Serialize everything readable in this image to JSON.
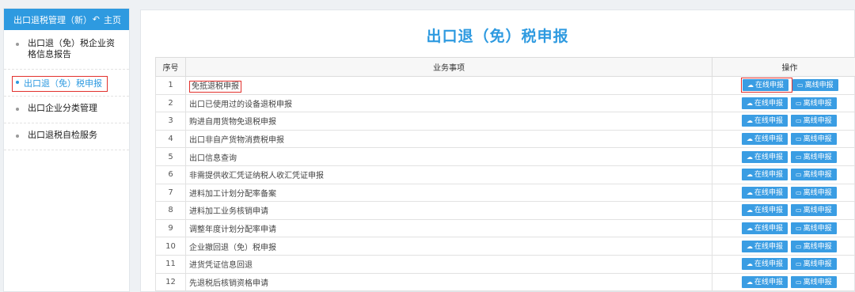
{
  "sidebar": {
    "title": "出口退税管理（新）",
    "home_label": "主页",
    "items": [
      {
        "label": "出口退（免）税企业资格信息报告"
      },
      {
        "label": "出口退（免）税申报"
      },
      {
        "label": "出口企业分类管理"
      },
      {
        "label": "出口退税自检服务"
      }
    ]
  },
  "main": {
    "title": "出口退（免）税申报",
    "columns": {
      "no": "序号",
      "item": "业务事项",
      "ops": "操作"
    },
    "online_label": "在线申报",
    "offline_label": "离线申报",
    "rows": [
      {
        "no": "1",
        "name": "免抵退税申报"
      },
      {
        "no": "2",
        "name": "出口已使用过的设备退税申报"
      },
      {
        "no": "3",
        "name": "购进自用货物免退税申报"
      },
      {
        "no": "4",
        "name": "出口非自产货物消费税申报"
      },
      {
        "no": "5",
        "name": "出口信息查询"
      },
      {
        "no": "6",
        "name": "非需提供收汇凭证纳税人收汇凭证申报"
      },
      {
        "no": "7",
        "name": "进料加工计划分配率备案"
      },
      {
        "no": "8",
        "name": "进料加工业务核销申请"
      },
      {
        "no": "9",
        "name": "调整年度计划分配率申请"
      },
      {
        "no": "10",
        "name": "企业撤回退（免）税申报"
      },
      {
        "no": "11",
        "name": "进货凭证信息回退"
      },
      {
        "no": "12",
        "name": "先退税后核销资格申请"
      }
    ]
  },
  "colors": {
    "accent": "#2e9ae0",
    "highlight": "#e2312d"
  }
}
